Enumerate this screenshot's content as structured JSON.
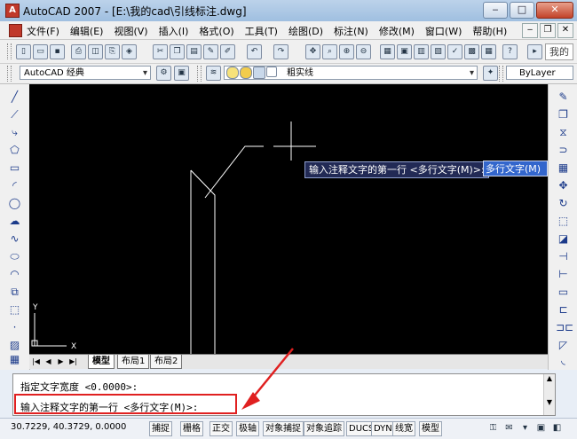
{
  "window": {
    "title": "AutoCAD 2007 - [E:\\我的cad\\引线标注.dwg]",
    "app_icon": "autocad-icon"
  },
  "menu": {
    "items": [
      "文件(F)",
      "编辑(E)",
      "视图(V)",
      "插入(I)",
      "格式(O)",
      "工具(T)",
      "绘图(D)",
      "标注(N)",
      "修改(M)",
      "窗口(W)",
      "帮助(H)"
    ],
    "help_search": "我的"
  },
  "workspace": {
    "current": "AutoCAD 经典"
  },
  "layer": {
    "current": "粗实线"
  },
  "color": {
    "current": "ByLayer"
  },
  "canvas": {
    "background": "#000000",
    "line_color": "#ffffff",
    "ucs": {
      "y_label": "Y",
      "x_label": "X"
    },
    "dynamic_prompt": "输入注释文字的第一行 <多行文字(M)>:",
    "dynamic_input": "多行文字(M)"
  },
  "layout_tabs": [
    "模型",
    "布局1",
    "布局2"
  ],
  "command": {
    "history": "指定文字宽度 <0.0000>:",
    "current_prompt": "输入注释文字的第一行 <多行文字(M)>:"
  },
  "status": {
    "coordinates": "30.7229, 40.3729, 0.0000",
    "toggles": [
      "捕捉",
      "栅格",
      "正交",
      "极轴",
      "对象捕捉",
      "对象追踪",
      "DUCS",
      "DYN",
      "线宽",
      "模型"
    ]
  },
  "accent_colors": {
    "highlight_box": "#e02020",
    "arrow": "#e02020"
  }
}
